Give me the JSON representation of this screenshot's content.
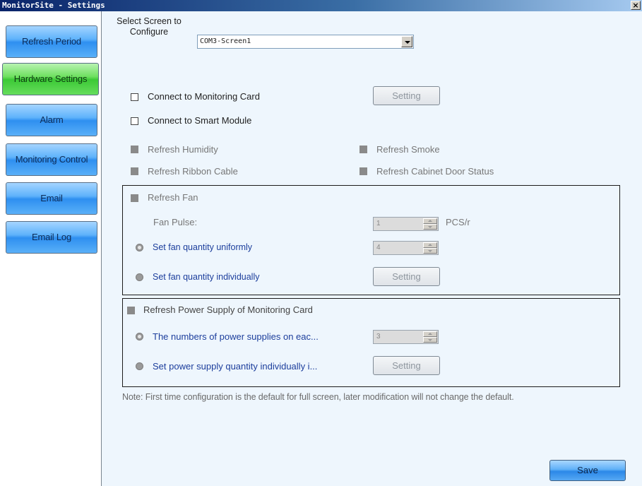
{
  "window": {
    "title": "MonitorSite - Settings",
    "close": "×"
  },
  "sidebar": {
    "items": [
      {
        "label": "Refresh Period"
      },
      {
        "label": "Hardware Settings"
      },
      {
        "label": "Alarm"
      },
      {
        "label": "Monitoring Control"
      },
      {
        "label": "Email"
      },
      {
        "label": "Email Log"
      }
    ],
    "active_item": "Hardware Settings"
  },
  "screen_select": {
    "label": "Select Screen to Configure",
    "value": "COM3-Screen1"
  },
  "options": {
    "connect_monitoring_card": {
      "label": "Connect to Monitoring Card",
      "checked": false,
      "button": "Setting"
    },
    "connect_smart_module": {
      "label": "Connect to Smart Module",
      "checked": false
    },
    "refresh_humidity": {
      "label": "Refresh Humidity",
      "enabled": false
    },
    "refresh_smoke": {
      "label": "Refresh Smoke",
      "enabled": false
    },
    "refresh_ribbon_cable": {
      "label": "Refresh Ribbon Cable",
      "enabled": false
    },
    "refresh_cabinet_door": {
      "label": "Refresh Cabinet Door Status",
      "enabled": false
    }
  },
  "fan": {
    "label": "Refresh Fan",
    "pulse_label": "Fan Pulse:",
    "pulse_value": "1",
    "pulse_unit": "PCS/r",
    "uniform_label": "Set fan quantity uniformly",
    "uniform_value": "4",
    "uniform_selected": true,
    "individual_label": "Set fan quantity individually",
    "individual_button": "Setting"
  },
  "power": {
    "label": "Refresh Power Supply of Monitoring Card",
    "each_label": "The numbers of power supplies on eac...",
    "each_value": "3",
    "each_selected": true,
    "individual_label": "Set power supply quantity individually i...",
    "individual_button": "Setting"
  },
  "note": "Note: First time configuration is the default for full screen, later modification will not change the default.",
  "save_label": "Save",
  "colors": {
    "active_nav": "#4cd043",
    "nav": "#3a98f2",
    "label_blue": "#1c3e9c"
  }
}
